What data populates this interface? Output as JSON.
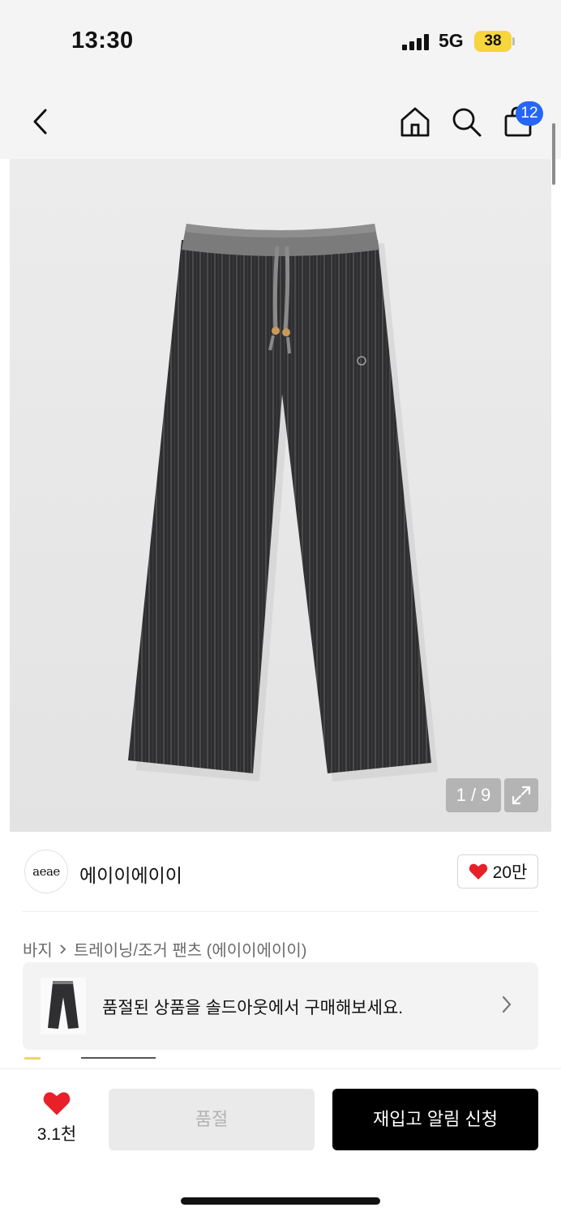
{
  "status_bar": {
    "time": "13:30",
    "network": "5G",
    "battery": "38"
  },
  "nav": {
    "cart_count": "12"
  },
  "gallery": {
    "counter": "1 / 9"
  },
  "brand": {
    "logo_text": "aeae",
    "name": "에이이에이이",
    "likes": "20만"
  },
  "breadcrumb": {
    "category": "바지",
    "subcategory": "트레이닝/조거 팬츠 (에이이에이이)"
  },
  "soldout_banner": {
    "message": "품절된 상품을 솔드아웃에서 구매해보세요."
  },
  "bottom_bar": {
    "like_count": "3.1천",
    "sold_out_label": "품절",
    "restock_label": "재입고 알림 신청"
  },
  "colors": {
    "accent_blue": "#2566f5",
    "heart_red": "#e8202a",
    "battery_yellow": "#f7d53c"
  }
}
